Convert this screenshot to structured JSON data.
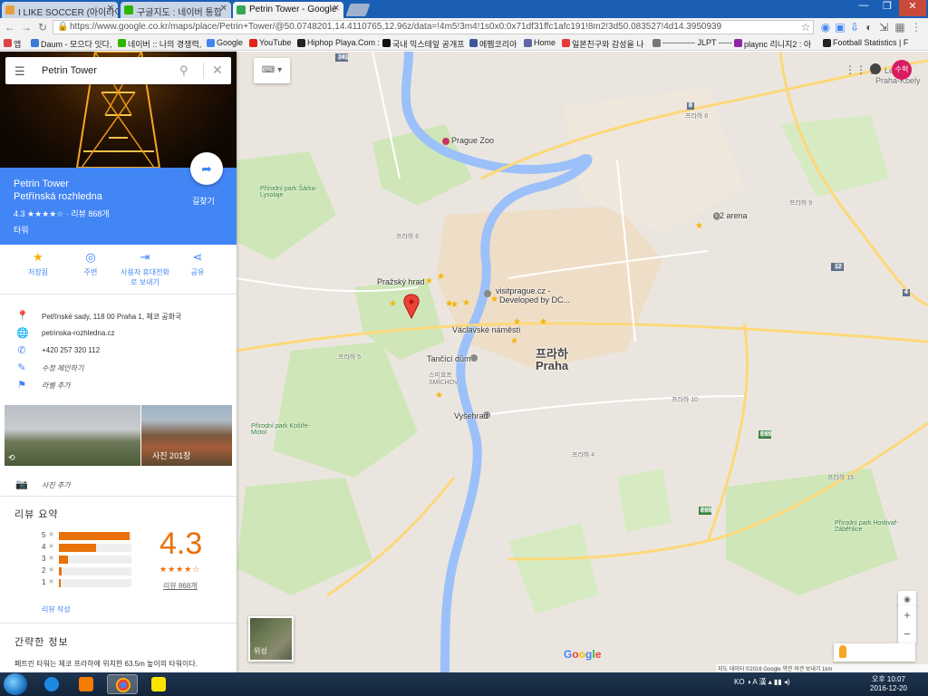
{
  "browser": {
    "tabs": [
      {
        "label": "I LIKE SOCCER (아이라이",
        "active": false
      },
      {
        "label": "구글지도 : 네이버 통합",
        "active": false
      },
      {
        "label": "Petrin Tower - Google",
        "active": true
      }
    ],
    "url": "https://www.google.co.kr/maps/place/Petrin+Tower/@50.0748201,14.4110765,12.96z/data=!4m5!3m4!1s0x0:0x71df31ffc1afc191!8m2!3d50.083527!4d14.3950939",
    "bookmarks": [
      {
        "label": "앱",
        "color": "#d44"
      },
      {
        "label": "Daum - 모으다 잇다,",
        "color": "#3a7bd5"
      },
      {
        "label": "네이버 :: 나의 경쟁력,",
        "color": "#2db400"
      },
      {
        "label": "Google",
        "color": "#4285f4"
      },
      {
        "label": "YouTube",
        "color": "#e62117"
      },
      {
        "label": "Hiphop Playa.Com :",
        "color": "#222"
      },
      {
        "label": "국내 믹스테잎 공개프",
        "color": "#111"
      },
      {
        "label": "에펨코리아",
        "color": "#3b5998"
      },
      {
        "label": "Home",
        "color": "#6264a7"
      },
      {
        "label": "일본친구와 감성을 나",
        "color": "#e53935"
      },
      {
        "label": "------------ JLPT -----",
        "color": "#777"
      },
      {
        "label": "plaync 리니지2 : 아",
        "color": "#8e24aa"
      },
      {
        "label": "Football Statistics | F",
        "color": "#222"
      }
    ]
  },
  "search": {
    "query": "Petrin Tower"
  },
  "place": {
    "name": "Petrin Tower",
    "name_local": "Petřínská rozhledna",
    "rating_line": "4.3 ★★★★☆ · 리뷰 868개",
    "category": "타워",
    "directions_label": "길찾기",
    "actions": [
      {
        "label": "저장됨",
        "icon": "star-icon",
        "glyph": "★"
      },
      {
        "label": "주변",
        "icon": "nearby-icon",
        "glyph": "◎"
      },
      {
        "label": "사용자 휴대전화로 보내기",
        "icon": "send-to-phone-icon",
        "glyph": "⇥"
      },
      {
        "label": "공유",
        "icon": "share-icon",
        "glyph": "⋖"
      }
    ],
    "info": [
      {
        "text": "Petřínské sady, 118 00 Praha 1, 체코 공화국",
        "icon": "location-pin-icon",
        "glyph": "⬤",
        "italic": false
      },
      {
        "text": "petrinska-rozhledna.cz",
        "icon": "globe-icon",
        "glyph": "◍",
        "italic": false
      },
      {
        "text": "+420 257 320 112",
        "icon": "phone-icon",
        "glyph": "✆",
        "italic": false
      },
      {
        "text": "수정 제안하기",
        "icon": "pencil-icon",
        "glyph": "✎",
        "italic": true
      },
      {
        "text": "라벨 추가",
        "icon": "flag-icon",
        "glyph": "⚑",
        "italic": true
      }
    ],
    "photos_count_label": "사진 201장",
    "add_photo_label": "사진 추가",
    "review_summary_title": "리뷰 요약",
    "rating_breakdown": [
      {
        "stars": "5",
        "fraction": 0.97
      },
      {
        "stars": "4",
        "fraction": 0.51
      },
      {
        "stars": "3",
        "fraction": 0.12
      },
      {
        "stars": "2",
        "fraction": 0.04
      },
      {
        "stars": "1",
        "fraction": 0.03
      }
    ],
    "rating_value": "4.3",
    "rating_stars": "★★★★☆",
    "review_count_label": "리뷰 868개",
    "write_review_label": "리뷰 작성",
    "about_title": "간략한 정보",
    "about_text": "페트린 타워는 체코 프라하에 위치한 63.5m 높이의 타워이다."
  },
  "map": {
    "labels": {
      "prague_zoo": "Prague Zoo",
      "o2_arena": "O2 arena",
      "letiste": "Letiště",
      "praha_kbely": "Praha-Kbely",
      "prazsky_hrad": "Pražský hrad",
      "visitprague": "visitprague.cz -",
      "visitprague2": "Developed by DC...",
      "vaclavske": "Václavské náměstí",
      "praha_kr": "프라하",
      "praha": "Praha",
      "tancici": "Tančící dům",
      "vysehrad": "Vyšehrad",
      "sarka": "Přírodní park Šárka-Lysolaje",
      "kosire": "Přírodní park Košíře-Motol",
      "hostivar": "Přírodní park Hostivař-Záběhlice",
      "smichov": "스미호프 SMÍCHOV",
      "praha6": "프라하 6",
      "praha8": "프라하 8",
      "praha9": "프라하 9",
      "praha10": "프라하 10",
      "praha15": "프라하 15",
      "praha4": "프라하 4",
      "praha5": "프라하 5",
      "road_241": "241",
      "road_12": "12",
      "road_e65": "E65",
      "road_8": "8",
      "road_4": "4"
    },
    "satellite_label": "위성",
    "footer": "지도 데이터 ©2016 Google   약관   의견 보내기   1km"
  },
  "taskbar": {
    "lang": "KO",
    "time": "오후 10:07",
    "date": "2016-12-20"
  }
}
